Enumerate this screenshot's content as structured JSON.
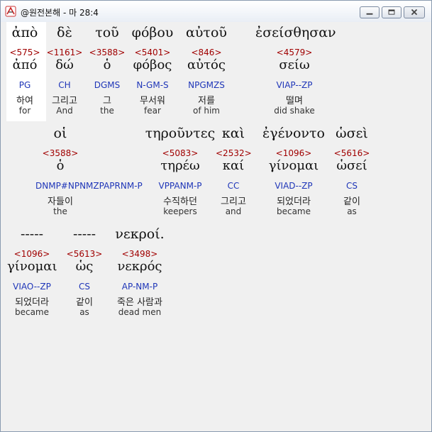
{
  "window": {
    "title": "@원전본해 - 마 28:4"
  },
  "rows": [
    [
      {
        "greek": "ἀπὸ",
        "strong": "<575>",
        "lemma": "ἀπό",
        "parsing": "PG",
        "korean": "하여",
        "english": "for"
      },
      {
        "greek": "δὲ",
        "strong": "<1161>",
        "lemma": "δώ",
        "parsing": "CH",
        "korean": "그리고",
        "english": "And"
      },
      {
        "greek": "τοῦ",
        "strong": "<3588>",
        "lemma": "ὁ",
        "parsing": "DGMS",
        "korean": "그",
        "english": "the"
      },
      {
        "greek": "φόβου",
        "strong": "<5401>",
        "lemma": "φόβος",
        "parsing": "N-GM-S",
        "korean": "무서워",
        "english": "fear"
      },
      {
        "greek": "αὐτοῦ",
        "strong": "<846>",
        "lemma": "αὐτός",
        "parsing": "NPGMZS",
        "korean": "저를",
        "english": "of him"
      },
      {
        "greek": "ἐσείσθησαν",
        "strong": "<4579>",
        "lemma": "σείω",
        "parsing": "VIAP--ZP",
        "korean": "떨며",
        "english": "did shake"
      }
    ],
    [
      {
        "greek": "οἱ",
        "strong": "<3588>",
        "lemma": "ὁ",
        "parsing": "DNMP#NPNMZPAPRNM-P",
        "korean": "자들이",
        "english": "the"
      },
      {
        "greek": "τηροῦντες",
        "strong": "<5083>",
        "lemma": "τηρέω",
        "parsing": "VPPANM-P",
        "korean": "수직하던",
        "english": "keepers"
      },
      {
        "greek": "καὶ",
        "strong": "<2532>",
        "lemma": "καί",
        "parsing": "CC",
        "korean": "그리고",
        "english": "and"
      },
      {
        "greek": "ἐγένοντο",
        "strong": "<1096>",
        "lemma": "γίνομαι",
        "parsing": "VIAD--ZP",
        "korean": "되었더라",
        "english": "became"
      },
      {
        "greek": "ὡσεὶ",
        "strong": "<5616>",
        "lemma": "ὡσεί",
        "parsing": "CS",
        "korean": "같이",
        "english": "as"
      }
    ],
    [
      {
        "greek": "-----",
        "strong": "<1096>",
        "lemma": "γίνομαι",
        "parsing": "VIAO--ZP",
        "korean": "되었더라",
        "english": "became"
      },
      {
        "greek": "-----",
        "strong": "<5613>",
        "lemma": "ὡς",
        "parsing": "CS",
        "korean": "같이",
        "english": "as"
      },
      {
        "greek": "νεκροί.",
        "strong": "<3498>",
        "lemma": "νεκρός",
        "parsing": "AP-NM-P",
        "korean": "죽은 사람과",
        "english": "dead men"
      }
    ]
  ],
  "icons": {
    "app": "app-logo-icon",
    "min": "minimize-icon",
    "max": "maximize-icon",
    "close": "close-icon"
  },
  "colors": {
    "strong": "#a00000",
    "parsing": "#1f36b8",
    "highlight": "#ffffff"
  }
}
